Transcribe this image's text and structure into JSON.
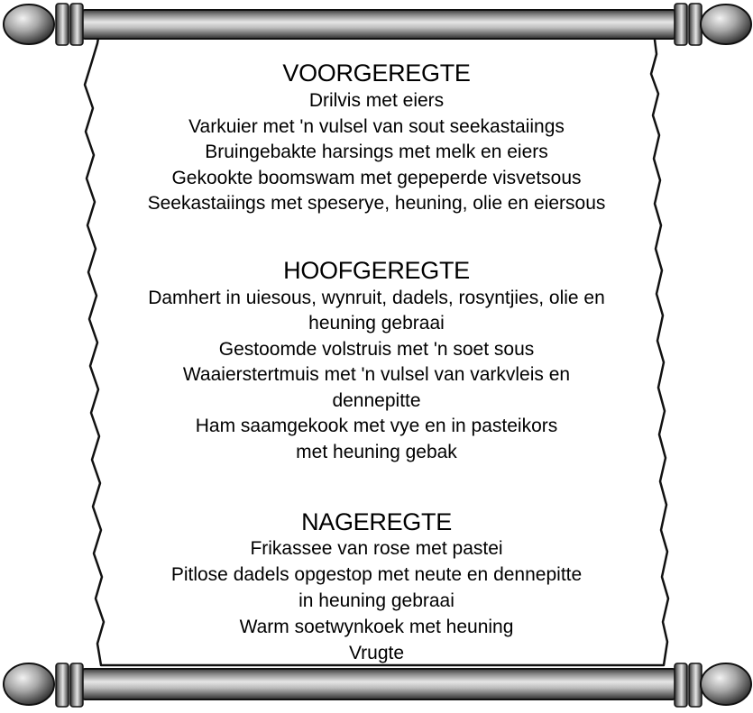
{
  "menu": {
    "sections": [
      {
        "title": "VOORGEREGTE",
        "lines": [
          "Drilvis met eiers",
          "Varkuier met 'n vulsel van sout seekastaiings",
          "Bruingebakte harsings met melk en eiers",
          "Gekookte boomswam met gepeperde visvetsous",
          "Seekastaiings met speserye, heuning, olie en eiersous"
        ]
      },
      {
        "title": "HOOFGEREGTE",
        "lines": [
          "Damhert in uiesous, wynruit, dadels, rosyntjies, olie en",
          "heuning gebraai",
          "Gestoomde volstruis met 'n soet sous",
          "Waaierstertmuis met 'n vulsel van varkvleis en",
          "dennepitte",
          "Ham saamgekook met vye en in pasteikors",
          "met heuning gebak"
        ]
      },
      {
        "title": "NAGEREGTE",
        "lines": [
          "Frikassee van rose met pastei",
          "Pitlose dadels opgestop met neute en dennepitte",
          "in heuning gebraai",
          "Warm soetwynkoek met heuning",
          "Vrugte"
        ]
      }
    ]
  },
  "colors": {
    "parchment": "#ffffff",
    "outline": "#111111",
    "rod_dark": "#3a3a3a",
    "rod_light": "#d8d8d8"
  },
  "icons": {
    "top_rod": "scroll-rod-icon",
    "bottom_rod": "scroll-rod-icon",
    "knob": "scroll-knob-icon"
  }
}
